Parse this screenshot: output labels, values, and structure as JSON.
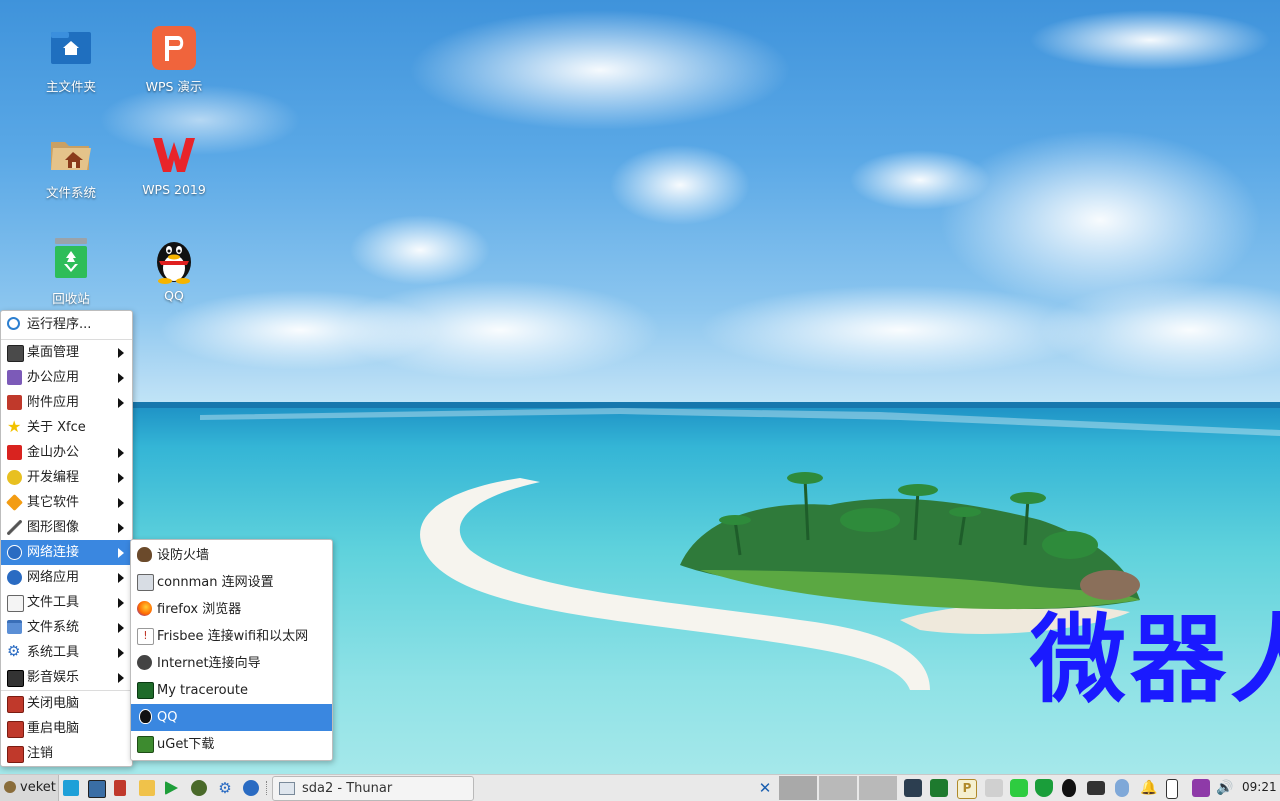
{
  "desktop": {
    "icons": [
      {
        "label": "主文件夹",
        "icon": "home-folder-icon"
      },
      {
        "label": "文件系统",
        "icon": "filesystem-icon"
      },
      {
        "label": "回收站",
        "icon": "trash-icon"
      },
      {
        "label": "WPS 演示",
        "icon": "wps-presentation-icon"
      },
      {
        "label": "WPS 2019",
        "icon": "wps-office-icon"
      },
      {
        "label": "QQ",
        "icon": "qq-penguin-icon"
      }
    ],
    "watermark": "微器人"
  },
  "menu": {
    "items": [
      {
        "label": "运行程序...",
        "icon": "search-icon"
      },
      {
        "label": "桌面管理",
        "icon": "desktop-settings-icon"
      },
      {
        "label": "办公应用",
        "icon": "office-icon"
      },
      {
        "label": "附件应用",
        "icon": "accessories-icon"
      },
      {
        "label": "关于 Xfce",
        "icon": "star-icon"
      },
      {
        "label": "金山办公",
        "icon": "wps-icon"
      },
      {
        "label": "开发编程",
        "icon": "development-icon"
      },
      {
        "label": "其它软件",
        "icon": "other-software-icon"
      },
      {
        "label": "图形图像",
        "icon": "graphics-icon"
      },
      {
        "label": "网络连接",
        "icon": "network-globe-icon"
      },
      {
        "label": "网络应用",
        "icon": "internet-globe-icon"
      },
      {
        "label": "文件工具",
        "icon": "file-tools-icon"
      },
      {
        "label": "文件系统",
        "icon": "folder-icon"
      },
      {
        "label": "系统工具",
        "icon": "gear-icon"
      },
      {
        "label": "影音娱乐",
        "icon": "multimedia-icon"
      },
      {
        "label": "关闭电脑",
        "icon": "shutdown-icon"
      },
      {
        "label": "重启电脑",
        "icon": "reboot-icon"
      },
      {
        "label": "注销",
        "icon": "logout-icon"
      }
    ]
  },
  "submenu": {
    "items": [
      {
        "label": "设防火墙",
        "icon": "firewall-icon"
      },
      {
        "label": "connman 连网设置",
        "icon": "network-settings-icon"
      },
      {
        "label": "firefox 浏览器",
        "icon": "firefox-icon"
      },
      {
        "label": "Frisbee 连接wifi和以太网",
        "icon": "wifi-icon"
      },
      {
        "label": "Internet连接向导",
        "icon": "internet-wizard-icon"
      },
      {
        "label": "My traceroute",
        "icon": "traceroute-icon"
      },
      {
        "label": "QQ",
        "icon": "qq-icon"
      },
      {
        "label": "uGet下载",
        "icon": "download-icon"
      }
    ]
  },
  "taskbar": {
    "start_label": "veket",
    "window_button": "sda2 - Thunar",
    "clock": "09:21"
  },
  "colors": {
    "highlight": "#3a87e0",
    "watermark": "#1a1aff",
    "taskbar": "#e9e9e9"
  }
}
